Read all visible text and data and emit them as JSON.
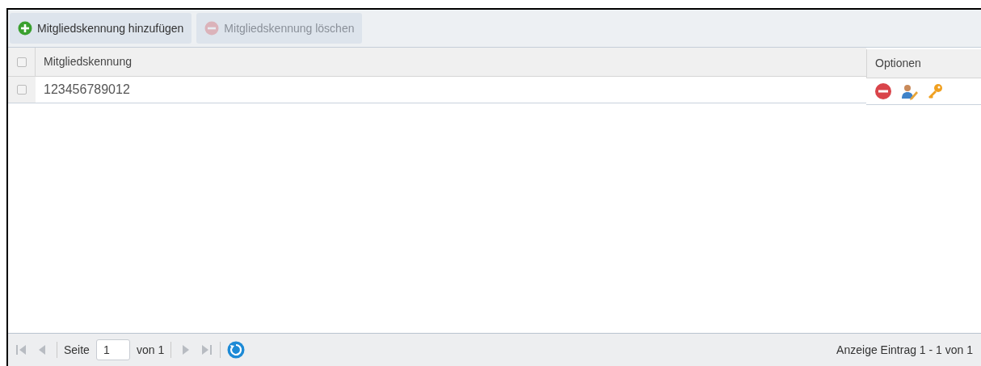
{
  "toolbar": [
    {
      "kind": "add",
      "label": "Mitgliedskennung hinzufügen",
      "disabled": false
    },
    {
      "kind": "delete",
      "label": "Mitgliedskennung löschen",
      "disabled": true
    }
  ],
  "table": {
    "select_all_checked": false,
    "columns": [
      "Mitgliedskennung"
    ],
    "options_header": "Optionen",
    "rows": [
      {
        "checked": false,
        "cells": [
          "123456789012"
        ],
        "actions": [
          {
            "kind": "delete"
          },
          {
            "kind": "edit"
          },
          {
            "kind": "key"
          }
        ]
      }
    ]
  },
  "pager": {
    "first_disabled": true,
    "prev_disabled": true,
    "page_label": "Seite",
    "page": "1",
    "of_label": "von 1",
    "next_disabled": true,
    "last_disabled": true,
    "status": "Anzeige Eintrag 1 - 1 von 1"
  }
}
